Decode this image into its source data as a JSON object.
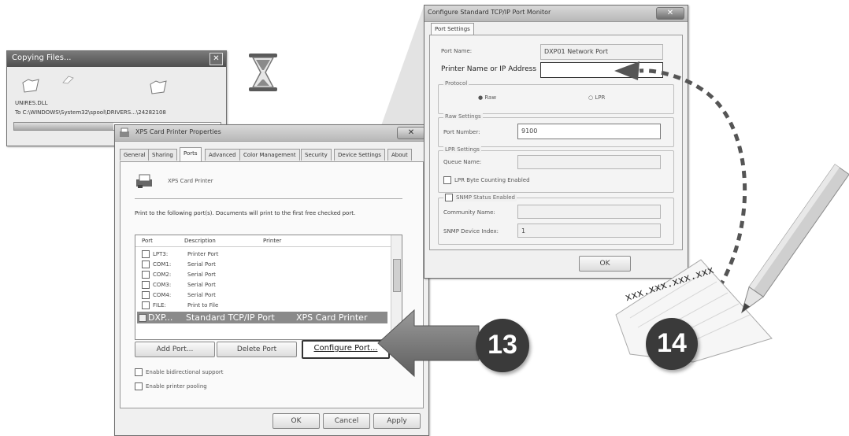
{
  "copy_dialog": {
    "title": "Copying Files...",
    "file": "UNIRES.DLL",
    "dest": "To C:\\WINDOWS\\System32\\spool\\DRIVERS...\\24282108",
    "close_glyph": "✕"
  },
  "props": {
    "title": "XPS Card Printer Properties",
    "tabs": [
      "General",
      "Sharing",
      "Ports",
      "Advanced",
      "Color Management",
      "Security",
      "Device Settings",
      "About"
    ],
    "printer_name": "XPS Card Printer",
    "instructions": "Print to the following port(s). Documents will print to the first free checked port.",
    "columns": {
      "port": "Port",
      "description": "Description",
      "printer": "Printer"
    },
    "ports": [
      {
        "port": "LPT3:",
        "description": "Printer Port",
        "printer": ""
      },
      {
        "port": "COM1:",
        "description": "Serial Port",
        "printer": ""
      },
      {
        "port": "COM2:",
        "description": "Serial Port",
        "printer": ""
      },
      {
        "port": "COM3:",
        "description": "Serial Port",
        "printer": ""
      },
      {
        "port": "COM4:",
        "description": "Serial Port",
        "printer": ""
      },
      {
        "port": "FILE:",
        "description": "Print to File",
        "printer": ""
      }
    ],
    "selected_port": {
      "port": "DXP...",
      "description": "Standard TCP/IP Port",
      "printer": "XPS Card Printer"
    },
    "add_port": "Add Port...",
    "delete_port": "Delete Port",
    "configure_port": "Configure Port...",
    "bidi": "Enable bidirectional support",
    "pooling": "Enable printer pooling",
    "ok": "OK",
    "cancel": "Cancel",
    "apply": "Apply"
  },
  "config": {
    "title": "Configure Standard TCP/IP Port Monitor",
    "tab": "Port Settings",
    "port_name_label": "Port Name:",
    "port_name_value": "DXP01 Network Port",
    "printer_ip_label": "Printer Name or IP Address",
    "printer_ip_value": "",
    "protocol_label": "Protocol",
    "raw": "Raw",
    "lpr": "LPR",
    "raw_settings_label": "Raw Settings",
    "port_number_label": "Port Number:",
    "port_number_value": "9100",
    "lpr_settings_label": "LPR Settings",
    "queue_name_label": "Queue Name:",
    "lpr_byte_counting": "LPR Byte Counting Enabled",
    "snmp_label": "SNMP Status Enabled",
    "community_label": "Community Name:",
    "device_index_label": "SNMP Device Index:",
    "device_index_value": "1",
    "ok": "OK"
  },
  "steps": {
    "step13": "13",
    "step14": "14"
  },
  "note": {
    "ip": "xxx.xxx.xxx.xxx"
  },
  "colors": {
    "badge": "#3a3a3a",
    "arrow": "#777777",
    "dashed": "#555555",
    "highlight": "#8a8a8a"
  }
}
